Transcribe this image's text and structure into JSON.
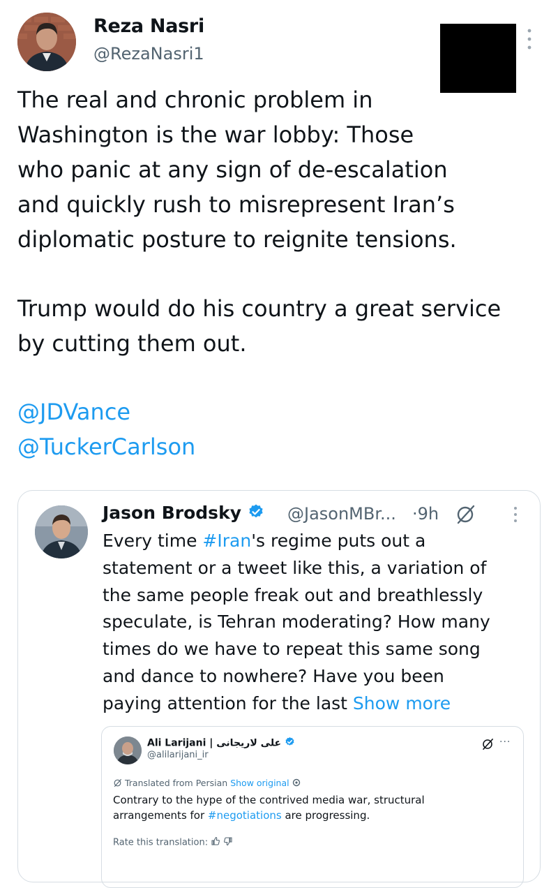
{
  "main_tweet": {
    "author_name": "Reza Nasri",
    "author_handle": "@RezaNasri1",
    "lines": [
      "The real and chronic problem in",
      "Washington is the war lobby: Those",
      "who panic at any sign of de-escalation",
      "and quickly rush to misrepresent Iran’s",
      "diplomatic posture to reignite tensions."
    ],
    "lines2": [
      "Trump would do his country a great service",
      "by cutting them out."
    ],
    "mentions": [
      "@JDVance",
      "@TuckerCarlson"
    ],
    "more_icon": "vertical-ellipsis-icon"
  },
  "quoted_tweet": {
    "author_name": "Jason Brodsky",
    "author_handle": "@JasonMBr...",
    "time": "·9h",
    "verified_icon": "verified-badge-icon",
    "line1_prefix": "Every time ",
    "line1_hashtag": "#Iran",
    "line1_suffix": "'s regime puts out a",
    "lines": [
      "statement or a tweet like this, a variation of",
      "the same people freak out and breathlessly",
      "speculate, is Tehran moderating? How many",
      "times do we have to repeat this same song",
      "and dance to nowhere? Have you been"
    ],
    "last_line": "paying attention for the last ",
    "show_more": "Show more",
    "accent": "#1d9bf0"
  },
  "nested_tweet": {
    "author_name": "Ali Larijani | علی لاریجانی",
    "author_handle": "@alilarijani_ir",
    "translated_label": "Translated from Persian",
    "show_original": "Show original",
    "line1": "Contrary to the hype of the contrived media war, structural",
    "line2_prefix": "arrangements for ",
    "line2_hashtag": "#negotiations",
    "line2_suffix": " are progressing.",
    "rate_label": "Rate this translation:",
    "more": "···"
  }
}
